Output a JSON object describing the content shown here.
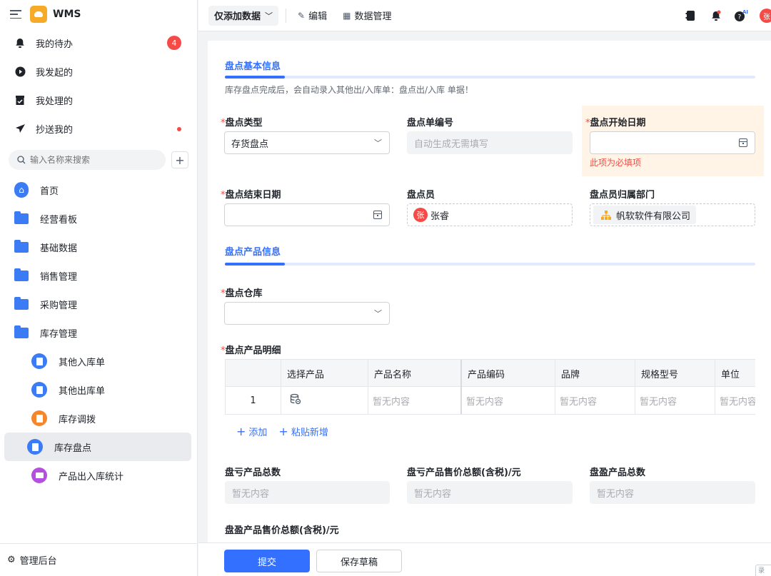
{
  "app": {
    "name": "WMS"
  },
  "sidebar": {
    "quick": [
      {
        "label": "我的待办",
        "badge": "4"
      },
      {
        "label": "我发起的"
      },
      {
        "label": "我处理的"
      },
      {
        "label": "抄送我的"
      }
    ],
    "search_placeholder": "输入名称来搜索",
    "nav": [
      {
        "label": "首页"
      },
      {
        "label": "经营看板"
      },
      {
        "label": "基础数据"
      },
      {
        "label": "销售管理"
      },
      {
        "label": "采购管理"
      },
      {
        "label": "库存管理"
      }
    ],
    "sub": [
      {
        "label": "其他入库单",
        "color": "#3b7cf5"
      },
      {
        "label": "其他出库单",
        "color": "#3b7cf5"
      },
      {
        "label": "库存调拨",
        "color": "#f5862b"
      },
      {
        "label": "库存盘点",
        "color": "#3b7cf5"
      },
      {
        "label": "产品出入库统计",
        "color": "#b44fe0"
      }
    ],
    "admin_label": "管理后台"
  },
  "topbar": {
    "mode": "仅添加数据",
    "edit": "编辑",
    "data_manage": "数据管理",
    "avatar": "张"
  },
  "form": {
    "section1": "盘点基本信息",
    "hint": "库存盘点完成后，会自动录入其他出/入库单：盘点出/入库 单据！",
    "type_label": "盘点类型",
    "type_value": "存货盘点",
    "no_label": "盘点单编号",
    "no_placeholder": "自动生成无需填写",
    "start_label": "盘点开始日期",
    "required_msg": "此项为必填项",
    "end_label": "盘点结束日期",
    "clerk_label": "盘点员",
    "clerk_avatar": "张",
    "clerk_name": "张睿",
    "dept_label": "盘点员归属部门",
    "dept_name": "帆软软件有限公司",
    "section2": "盘点产品信息",
    "warehouse_label": "盘点仓库",
    "detail_label": "盘点产品明细",
    "table": {
      "headers": [
        "",
        "选择产品",
        "产品名称",
        "产品编码",
        "品牌",
        "规格型号",
        "单位"
      ],
      "row_index": "1",
      "empty": "暂无内容"
    },
    "add": "添加",
    "paste": "粘贴新增",
    "loss_count_label": "盘亏产品总数",
    "loss_amount_label": "盘亏产品售价总额(含税)/元",
    "gain_count_label": "盘盈产品总数",
    "gain_amount_label": "盘盈产品售价总额(含税)/元",
    "empty": "暂无内容"
  },
  "footer": {
    "submit": "提交",
    "draft": "保存草稿",
    "corner": "录"
  },
  "colors": {
    "primary": "#3370ff",
    "danger": "#f54a45",
    "warn_bg": "#fff4e6"
  }
}
